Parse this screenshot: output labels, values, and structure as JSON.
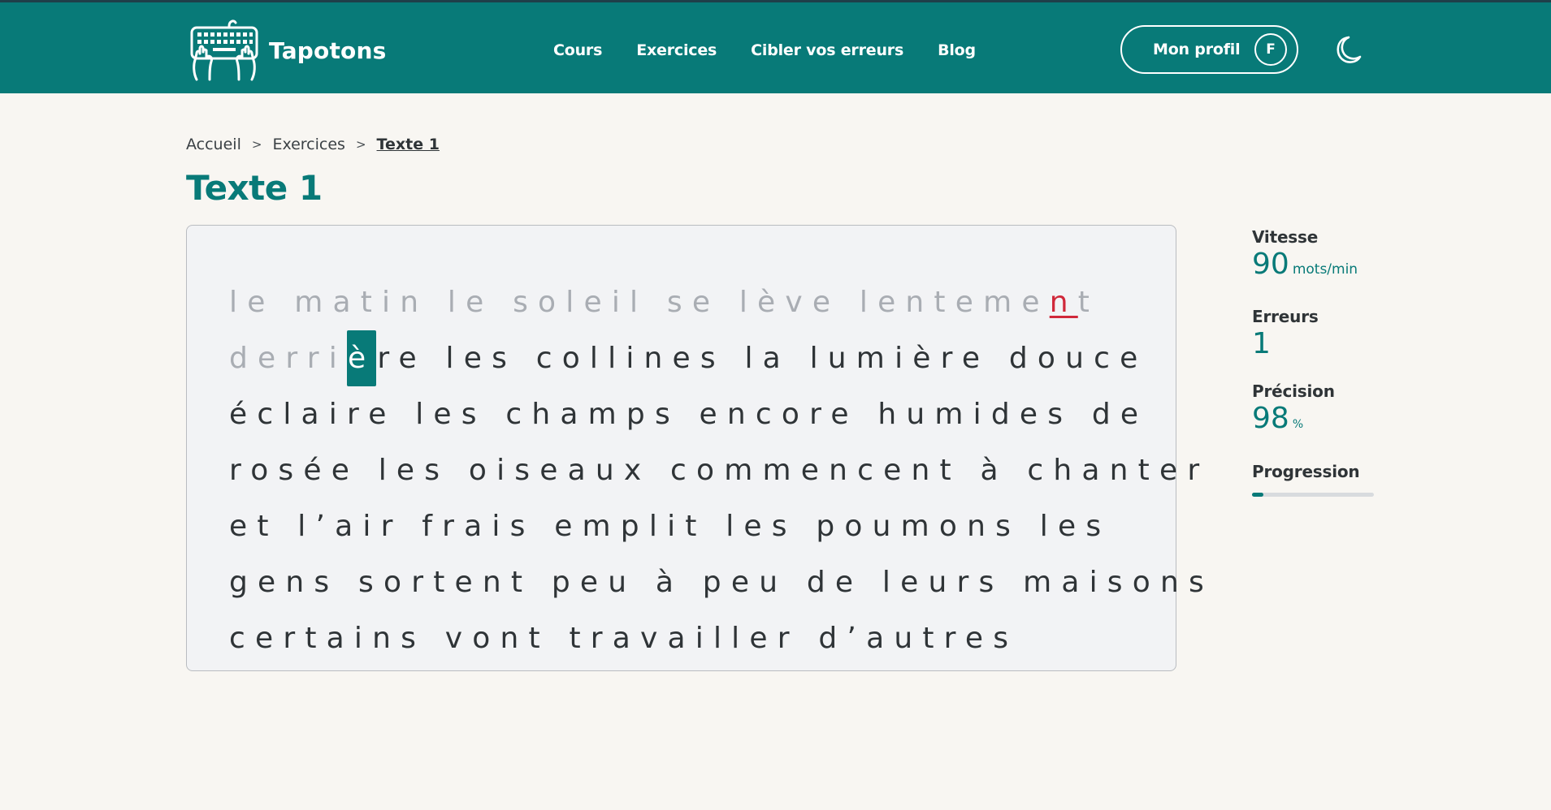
{
  "brand": {
    "name": "Tapotons",
    "logo_icon": "keyboard-hands-icon"
  },
  "nav": {
    "items": [
      "Cours",
      "Exercices",
      "Cibler vos erreurs",
      "Blog"
    ]
  },
  "profile": {
    "label": "Mon profil",
    "initial": "F"
  },
  "theme_toggle": {
    "icon": "moon-icon"
  },
  "breadcrumb": {
    "items": [
      "Accueil",
      "Exercices"
    ],
    "current": "Texte 1"
  },
  "page_title": "Texte 1",
  "exercise": {
    "line1": {
      "typed": "le matin le soleil se lève lenteme",
      "error": "n",
      "typed_after": "t"
    },
    "line2": {
      "typed": "derri",
      "cursor": "è",
      "rest": "re les collines la lumière douce"
    },
    "lines_pending": [
      "éclaire les champs encore humides de",
      "rosée les oiseaux commencent à chanter",
      "et l’air frais emplit les poumons les",
      "gens sortent peu à peu de leurs maisons",
      "certains vont travailler d’autres"
    ]
  },
  "stats": {
    "speed": {
      "label": "Vitesse",
      "value": "90",
      "unit": "mots/min"
    },
    "errors": {
      "label": "Erreurs",
      "value": "1"
    },
    "precision": {
      "label": "Précision",
      "value": "98",
      "unit": "%"
    },
    "progress": {
      "label": "Progression",
      "fraction": 0.09
    }
  },
  "colors": {
    "accent": "#087a78",
    "error": "#d0283a",
    "typed": "#a9adb3",
    "background": "#f8f6f2"
  }
}
